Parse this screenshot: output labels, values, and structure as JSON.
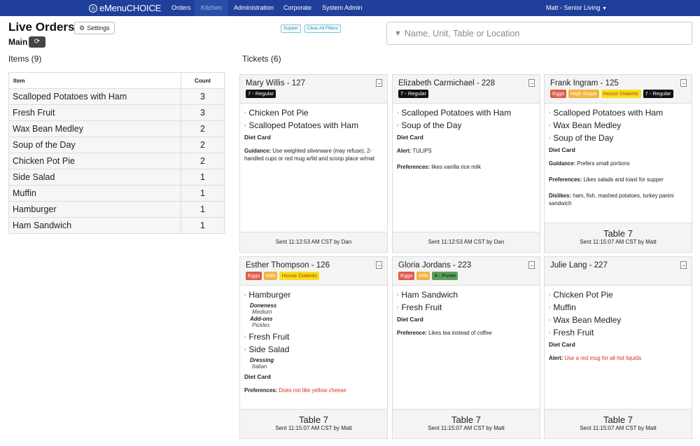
{
  "navbar": {
    "brand": "eMenuCHOICE",
    "items": [
      "Orders",
      "Kitchen",
      "Administration",
      "Corporate",
      "System Admin"
    ],
    "user": "Matt - Senior Living",
    "bg": "#1f3f9a"
  },
  "header": {
    "title": "Live Orders",
    "settings_label": "Settings",
    "main_label": "Main",
    "filters": [
      "Supper",
      "Clear All Filters"
    ],
    "search_placeholder": "Name, Unit, Table or Location"
  },
  "items": {
    "heading": "Items (9)",
    "col_item": "Item",
    "col_count": "Count",
    "rows": [
      {
        "name": "Scalloped Potatoes with Ham",
        "count": "3"
      },
      {
        "name": "Fresh Fruit",
        "count": "3"
      },
      {
        "name": "Wax Bean Medley",
        "count": "2"
      },
      {
        "name": "Soup of the Day",
        "count": "2"
      },
      {
        "name": "Chicken Pot Pie",
        "count": "2"
      },
      {
        "name": "Side Salad",
        "count": "1"
      },
      {
        "name": "Muffin",
        "count": "1"
      },
      {
        "name": "Hamburger",
        "count": "1"
      },
      {
        "name": "Ham Sandwich",
        "count": "1"
      }
    ]
  },
  "tickets": {
    "heading": "Tickets (6)",
    "list": [
      {
        "name": "Mary Willis - 127",
        "badges": [
          {
            "text": "7 - Regular",
            "style": "b-black"
          }
        ],
        "items": [
          "Chicken Pot Pie",
          "Scalloped Potatoes with Ham"
        ],
        "diet_card": "Diet Card",
        "notes": [
          {
            "label": "Guidance:",
            "text": "Use weighted silverware (may refuse), 2-handled cups or red mug w/lid and  scoop place w/mat",
            "red": false
          }
        ],
        "table": "",
        "sent": "Sent 11:12:53 AM CST by Dan"
      },
      {
        "name": "Elizabeth Carmichael - 228",
        "badges": [
          {
            "text": "7 - Regular",
            "style": "b-black"
          }
        ],
        "items": [
          "Scalloped Potatoes with Ham",
          "Soup of the Day"
        ],
        "diet_card": "Diet Card",
        "notes": [
          {
            "label": "Alert:",
            "text": "TULIPS",
            "red": false
          },
          {
            "label": "Preferences:",
            "text": "likes vanilla rice milk",
            "red": false
          }
        ],
        "table": "",
        "sent": "Sent 11:12:53 AM CST by Dan"
      },
      {
        "name": "Frank Ingram - 125",
        "badges": [
          {
            "text": "Eggs",
            "style": "b-red"
          },
          {
            "text": "High Sugar",
            "style": "b-orange"
          },
          {
            "text": "House Diabetic",
            "style": "b-yellow"
          },
          {
            "text": "7 - Regular",
            "style": "b-black"
          }
        ],
        "items": [
          "Scalloped Potatoes with Ham",
          "Wax Bean Medley",
          "Soup of the Day"
        ],
        "diet_card": "Diet Card",
        "notes": [
          {
            "label": "Guidance:",
            "text": "Prefers small portions",
            "red": false
          },
          {
            "label": "Preferences:",
            "text": "Likes salads and toast for supper",
            "red": false
          },
          {
            "label": "Dislikes:",
            "text": "ham, fish, mashed potatoes, turkey panini sandwich",
            "red": false
          }
        ],
        "table": "Table 7",
        "sent": "Sent 11:15:07 AM CST by Matt"
      },
      {
        "name": "Esther Thompson - 126",
        "badges": [
          {
            "text": "Eggs",
            "style": "b-red"
          },
          {
            "text": "Milk",
            "style": "b-orange"
          },
          {
            "text": "House Diabetic",
            "style": "b-yellow"
          }
        ],
        "items": [
          "Hamburger",
          "Fresh Fruit",
          "Side Salad"
        ],
        "modifiers": {
          "Hamburger": [
            {
              "head": "Doneness",
              "val": "Medium"
            },
            {
              "head": "Add-ons",
              "val": "Pickles"
            }
          ],
          "Side Salad": [
            {
              "head": "Dressing",
              "val": "Italian"
            }
          ]
        },
        "diet_card": "Diet Card",
        "notes": [
          {
            "label": "Preferences:",
            "text": "Does not like yellow cheese",
            "red": true
          }
        ],
        "table": "Table 7",
        "sent": "Sent 11:15:07 AM CST by Matt"
      },
      {
        "name": "Gloria Jordans - 223",
        "badges": [
          {
            "text": "Eggs",
            "style": "b-red"
          },
          {
            "text": "Milk",
            "style": "b-orange"
          },
          {
            "text": "4 - Puree",
            "style": "b-green"
          }
        ],
        "items": [
          "Ham Sandwich",
          "Fresh Fruit"
        ],
        "diet_card": "Diet Card",
        "notes": [
          {
            "label": "Preference:",
            "text": "Likes tea instead of coffee",
            "red": false
          }
        ],
        "table": "Table 7",
        "sent": "Sent 11:15:07 AM CST by Matt"
      },
      {
        "name": "Julie Lang - 227",
        "badges": [],
        "items": [
          "Chicken Pot Pie",
          "Muffin",
          "Wax Bean Medley",
          "Fresh Fruit"
        ],
        "diet_card": "Diet Card",
        "notes": [
          {
            "label": "Alert:",
            "text": "Use a red mug for all hot liquids",
            "red": true
          }
        ],
        "table": "Table 7",
        "sent": "Sent 11:15:07 AM CST by Matt"
      }
    ]
  }
}
